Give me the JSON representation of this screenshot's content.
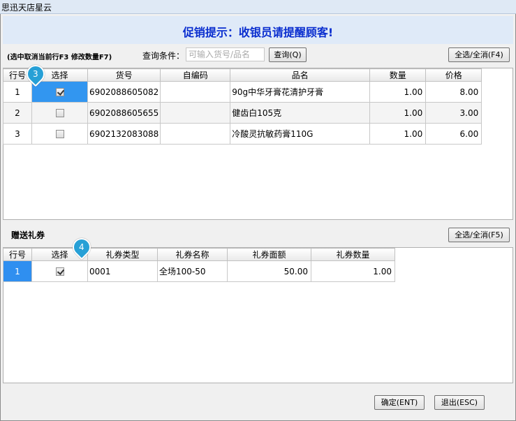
{
  "window": {
    "title": "思迅天店星云"
  },
  "promo": {
    "text": "促销提示：收银员请提醒顾客!"
  },
  "toolbar": {
    "hint": "(选中取消当前行F3  修改数量F7)",
    "query_label": "查询条件：",
    "query_placeholder": "可输入货号/品名",
    "query_value": "",
    "query_button": "查询(Q)",
    "select_all_button": "全选/全消(F4)"
  },
  "products": {
    "columns": [
      "行号",
      "选择",
      "货号",
      "自编码",
      "品名",
      "数量",
      "价格"
    ],
    "rows": [
      {
        "no": "1",
        "checked": true,
        "code": "6902088605082",
        "self_code": "",
        "name": "90g中华牙膏花清护牙膏",
        "qty": "1.00",
        "price": "8.00"
      },
      {
        "no": "2",
        "checked": false,
        "code": "6902088605655",
        "self_code": "",
        "name": "健齿白105克",
        "qty": "1.00",
        "price": "3.00"
      },
      {
        "no": "3",
        "checked": false,
        "code": "6902132083088",
        "self_code": "",
        "name": "冷酸灵抗敏药膏110G",
        "qty": "1.00",
        "price": "6.00"
      }
    ]
  },
  "gift": {
    "label": "赠送礼券",
    "select_all_button": "全选/全消(F5)",
    "columns": [
      "行号",
      "选择",
      "礼券类型",
      "礼券名称",
      "礼券面额",
      "礼券数量"
    ],
    "rows": [
      {
        "no": "1",
        "checked": true,
        "type": "0001",
        "name": "全场100-50",
        "amount": "50.00",
        "qty": "1.00"
      }
    ]
  },
  "footer": {
    "confirm_button": "确定(ENT)",
    "exit_button": "退出(ESC)"
  },
  "markers": {
    "m1": "3",
    "m2": "4"
  },
  "colors": {
    "promo_text": "#0a2ecf",
    "selection": "#3296f0",
    "marker": "#27a0d6"
  }
}
